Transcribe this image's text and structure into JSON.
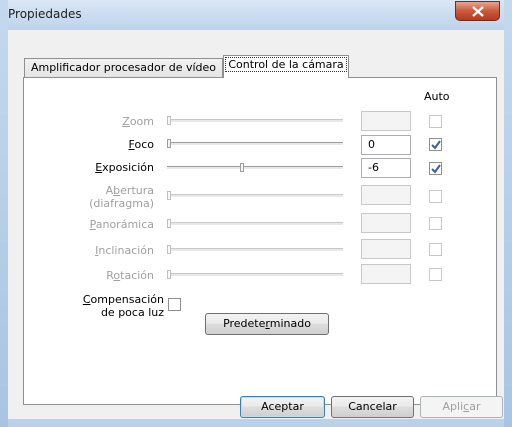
{
  "window": {
    "title": "Propiedades",
    "close_icon": "close-icon"
  },
  "tabs": [
    {
      "label": "Amplificador procesador de vídeo",
      "selected": false
    },
    {
      "label": "Control de la cámara",
      "selected": true
    }
  ],
  "camera_controls": {
    "auto_header": "Auto",
    "rows": [
      {
        "label_pre": "",
        "label_key": "Z",
        "label_post": "oom",
        "enabled": false,
        "value": "",
        "auto": false,
        "slider_fraction": 0
      },
      {
        "label_pre": "",
        "label_key": "F",
        "label_post": "oco",
        "enabled": true,
        "value": "0",
        "auto": true,
        "slider_fraction": 0
      },
      {
        "label_pre": "",
        "label_key": "E",
        "label_post": "xposición",
        "enabled": true,
        "value": "-6",
        "auto": true,
        "slider_fraction": 0.42
      },
      {
        "label_pre": "A",
        "label_key": "b",
        "label_post": "ertura",
        "label_line2": "(diafragma)",
        "enabled": false,
        "value": "",
        "auto": false,
        "slider_fraction": 0
      },
      {
        "label_pre": "",
        "label_key": "P",
        "label_post": "anorámica",
        "enabled": false,
        "value": "",
        "auto": false,
        "slider_fraction": 0
      },
      {
        "label_pre": "",
        "label_key": "I",
        "label_post": "nclinación",
        "enabled": false,
        "value": "",
        "auto": false,
        "slider_fraction": 0
      },
      {
        "label_pre": "R",
        "label_key": "o",
        "label_post": "tación",
        "enabled": false,
        "value": "",
        "auto": false,
        "slider_fraction": 0
      }
    ],
    "low_light": {
      "label_key": "C",
      "label_post": "ompensación",
      "label_line2": "de poca luz",
      "checked": false
    },
    "default_button": {
      "pre": "Predete",
      "key": "r",
      "post": "minado"
    }
  },
  "footer": {
    "ok": "Aceptar",
    "cancel": "Cancelar",
    "apply_pre": "Apli",
    "apply_key": "c",
    "apply_post": "ar"
  },
  "colors": {
    "accent": "#3c7fb1",
    "close_button": "#c95a3c",
    "disabled_text": "#a0a0a0"
  }
}
